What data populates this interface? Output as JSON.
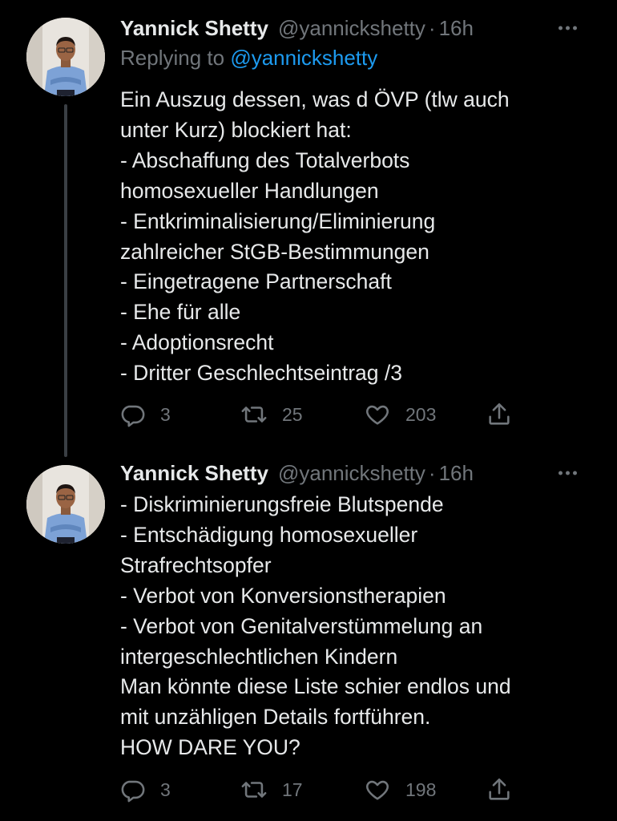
{
  "colors": {
    "background": "#000000",
    "text": "#e7e9ea",
    "muted": "#71767b",
    "link": "#1d9bf0",
    "thread_line": "#3a3f44"
  },
  "tweets": [
    {
      "author_name": "Yannick Shetty",
      "handle": "@yannickshetty",
      "separator": "·",
      "time": "16h",
      "replying_prefix": "Replying to",
      "replying_to": "@yannickshetty",
      "text": "Ein Auszug dessen, was d ÖVP (tlw auch\nunter Kurz) blockiert hat:\n- Abschaffung des Totalverbots\nhomosexueller Handlungen\n- Entkriminalisierung/Eliminierung\nzahlreicher StGB-Bestimmungen\n- Eingetragene Partnerschaft\n- Ehe für alle\n- Adoptionsrecht\n- Dritter Geschlechtseintrag /3",
      "replies": "3",
      "retweets": "25",
      "likes": "203",
      "icons": [
        "reply-icon",
        "retweet-icon",
        "like-icon",
        "share-icon",
        "more-icon"
      ]
    },
    {
      "author_name": "Yannick Shetty",
      "handle": "@yannickshetty",
      "separator": "·",
      "time": "16h",
      "text": "- Diskriminierungsfreie Blutspende\n- Entschädigung homosexueller\nStrafrechtsopfer\n- Verbot von Konversionstherapien\n- Verbot von Genitalverstümmelung an\nintergeschlechtlichen Kindern\nMan könnte diese Liste schier endlos und\nmit unzähligen Details fortführen.\nHOW DARE YOU?",
      "replies": "3",
      "retweets": "17",
      "likes": "198",
      "icons": [
        "reply-icon",
        "retweet-icon",
        "like-icon",
        "share-icon",
        "more-icon"
      ]
    }
  ]
}
